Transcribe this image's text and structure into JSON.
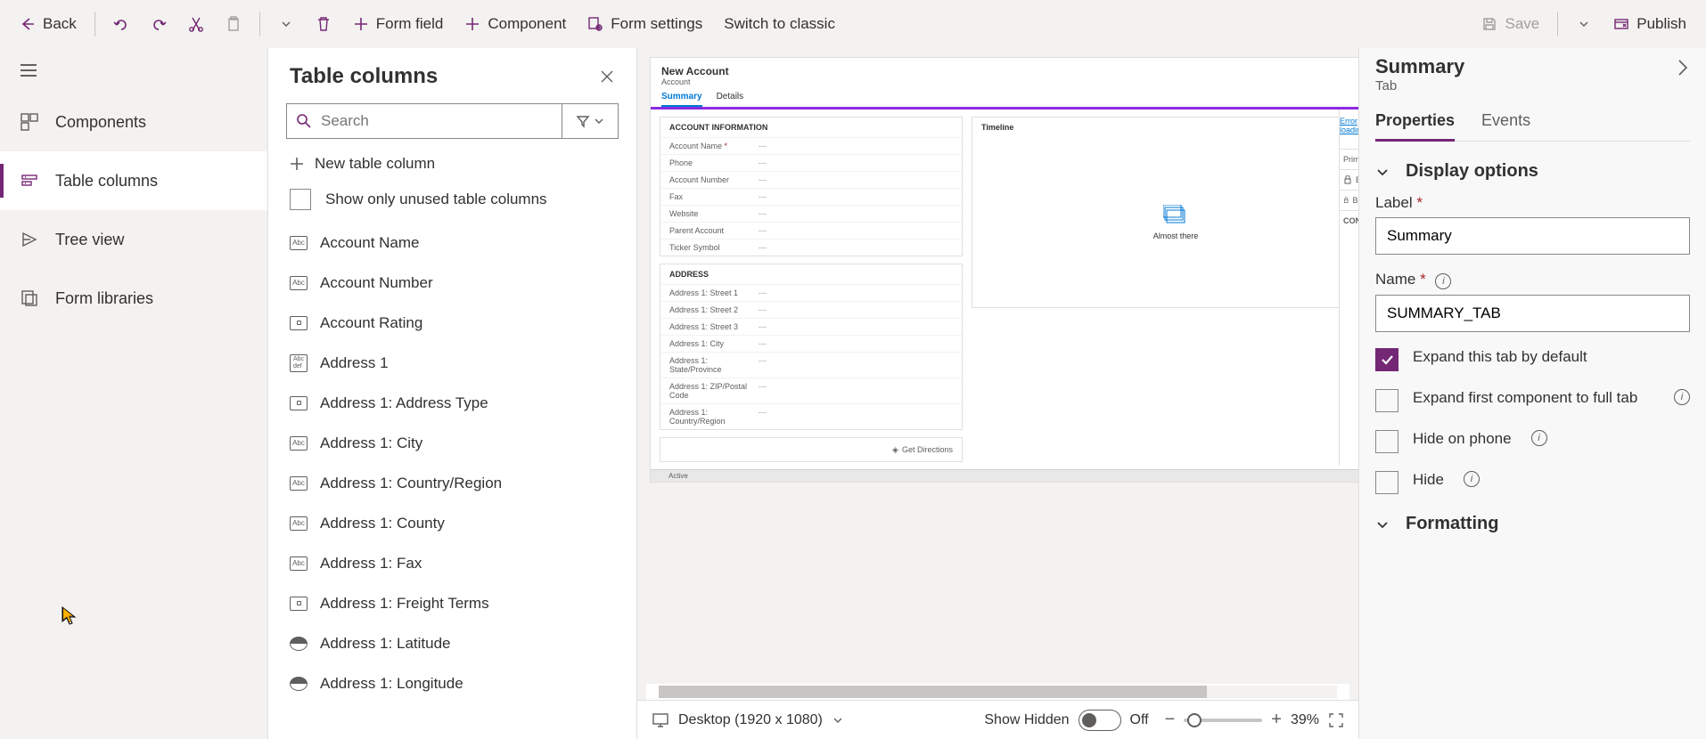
{
  "cmdbar": {
    "back": "Back",
    "formField": "Form field",
    "component": "Component",
    "formSettings": "Form settings",
    "switchClassic": "Switch to classic",
    "save": "Save",
    "publish": "Publish"
  },
  "leftNav": {
    "components": "Components",
    "tableColumns": "Table columns",
    "treeView": "Tree view",
    "formLibraries": "Form libraries"
  },
  "tableColumns": {
    "title": "Table columns",
    "searchPlaceholder": "Search",
    "newColumn": "New table column",
    "unusedLabel": "Show only unused table columns",
    "items": [
      {
        "icon": "Abc",
        "label": "Account Name"
      },
      {
        "icon": "Abc",
        "label": "Account Number"
      },
      {
        "icon": "opt",
        "label": "Account Rating"
      },
      {
        "icon": "Abc\ndef",
        "label": "Address 1"
      },
      {
        "icon": "opt",
        "label": "Address 1: Address Type"
      },
      {
        "icon": "Abc",
        "label": "Address 1: City"
      },
      {
        "icon": "Abc",
        "label": "Address 1: Country/Region"
      },
      {
        "icon": "Abc",
        "label": "Address 1: County"
      },
      {
        "icon": "Abc",
        "label": "Address 1: Fax"
      },
      {
        "icon": "opt",
        "label": "Address 1: Freight Terms"
      },
      {
        "icon": "geo",
        "label": "Address 1: Latitude"
      },
      {
        "icon": "geo",
        "label": "Address 1: Longitude"
      }
    ]
  },
  "form": {
    "title": "New Account",
    "entity": "Account",
    "tabs": [
      "Summary",
      "Details"
    ],
    "errorLoading": "Error loading",
    "accountInfo": {
      "header": "ACCOUNT INFORMATION",
      "rows": [
        {
          "label": "Account Name",
          "req": "*",
          "val": "---"
        },
        {
          "label": "Phone",
          "val": "---"
        },
        {
          "label": "Account Number",
          "val": "---"
        },
        {
          "label": "Fax",
          "val": "---"
        },
        {
          "label": "Website",
          "val": "---"
        },
        {
          "label": "Parent Account",
          "val": "---"
        },
        {
          "label": "Ticker Symbol",
          "val": "---"
        }
      ]
    },
    "address": {
      "header": "ADDRESS",
      "rows": [
        {
          "label": "Address 1: Street 1",
          "val": "---"
        },
        {
          "label": "Address 1: Street 2",
          "val": "---"
        },
        {
          "label": "Address 1: Street 3",
          "val": "---"
        },
        {
          "label": "Address 1: City",
          "val": "---"
        },
        {
          "label": "Address 1: State/Province",
          "val": "---"
        },
        {
          "label": "Address 1: ZIP/Postal Code",
          "val": "---"
        },
        {
          "label": "Address 1: Country/Region",
          "val": "---"
        }
      ]
    },
    "timeline": {
      "header": "Timeline",
      "loading": "Almost there"
    },
    "getDirections": "Get Directions",
    "footerState": "Active",
    "rightCells": {
      "primaryCo": "Primary Co",
      "email": "Email",
      "business": "Business",
      "contacts": "CONTACTS"
    }
  },
  "canvasBar": {
    "device": "Desktop (1920 x 1080)",
    "showHidden": "Show Hidden",
    "toggleState": "Off",
    "zoom": "39%"
  },
  "props": {
    "title": "Summary",
    "subtitle": "Tab",
    "tabProperties": "Properties",
    "tabEvents": "Events",
    "displayOptions": "Display options",
    "labelLabel": "Label",
    "labelValue": "Summary",
    "nameLabel": "Name",
    "nameValue": "SUMMARY_TAB",
    "expandDefault": "Expand this tab by default",
    "expandFirst": "Expand first component to full tab",
    "hidePhone": "Hide on phone",
    "hide": "Hide",
    "formatting": "Formatting"
  }
}
